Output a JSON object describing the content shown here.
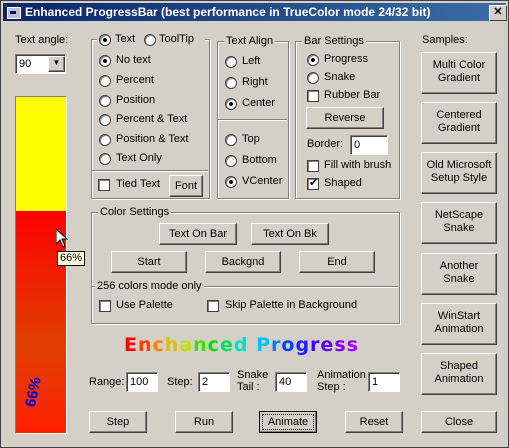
{
  "window": {
    "title": "Enhanced ProgressBar (best performance in TrueColor mode 24/32 bit)",
    "close_glyph": "✕"
  },
  "text_angle": {
    "label": "Text angle:",
    "value": "90"
  },
  "progress": {
    "value_fraction": 0.66,
    "text": "66%",
    "tooltip": "66%",
    "fill_color": "#ff0000",
    "empty_color": "#ffff00",
    "text_color": "#0000cc"
  },
  "text_group": {
    "mode_text": "Text",
    "mode_tooltip": "ToolTip",
    "options": [
      "No text",
      "Percent",
      "Position",
      "Percent & Text",
      "Position & Text",
      "Text Only"
    ],
    "tied_text": "Tied Text",
    "font_button": "Font"
  },
  "text_align": {
    "caption": "Text Align",
    "h_options": [
      "Left",
      "Right",
      "Center"
    ],
    "v_options": [
      "Top",
      "Bottom",
      "VCenter"
    ]
  },
  "bar_settings": {
    "caption": "Bar Settings",
    "progress": "Progress",
    "snake": "Snake",
    "rubber_bar": "Rubber Bar",
    "reverse_button": "Reverse",
    "border_label": "Border:",
    "border_value": "0",
    "fill_with_brush": "Fill with brush",
    "shaped": "Shaped"
  },
  "color_settings": {
    "caption": "Color Settings",
    "text_on_bar": "Text On Bar",
    "text_on_bk": "Text On Bk",
    "start": "Start",
    "backgnd": "Backgnd",
    "end": "End",
    "sub_caption": "256 colors mode only",
    "use_palette": "Use Palette",
    "skip_palette": "Skip Palette in Background"
  },
  "fancy_text": {
    "letters": [
      "E",
      "n",
      "c",
      "h",
      "a",
      "n",
      "c",
      "e",
      "d",
      " ",
      "P",
      "r",
      "o",
      "g",
      "r",
      "e",
      "s",
      "s"
    ],
    "colors": [
      "#ff0000",
      "#ff4000",
      "#ff8000",
      "#e0c000",
      "#c0e000",
      "#40e000",
      "#00e000",
      "#00e060",
      "#00e0c0",
      "#ffffff",
      "#00c0ff",
      "#0080ff",
      "#0040ff",
      "#2020ff",
      "#4000ff",
      "#6000ff",
      "#8000ff",
      "#a000ff"
    ]
  },
  "params": {
    "range_label": "Range:",
    "range_value": "100",
    "step_label": "Step:",
    "step_value": "2",
    "snake_tail_label_1": "Snake",
    "snake_tail_label_2": "Tail :",
    "snake_tail_value": "40",
    "anim_step_label_1": "Animation",
    "anim_step_label_2": "Step :",
    "anim_step_value": "1"
  },
  "bottom_buttons": {
    "step": "Step",
    "run": "Run",
    "animate": "Animate",
    "reset": "Reset",
    "close": "Close"
  },
  "samples": {
    "caption": "Samples:",
    "items": [
      [
        "Multi Color",
        "Gradient"
      ],
      [
        "Centered",
        "Gradient"
      ],
      [
        "Old Microsoft",
        "Setup Style"
      ],
      [
        "NetScape",
        "Snake"
      ],
      [
        "Another",
        "Snake"
      ],
      [
        "WinStart",
        "Animation"
      ],
      [
        "Shaped",
        "Animation"
      ]
    ]
  }
}
